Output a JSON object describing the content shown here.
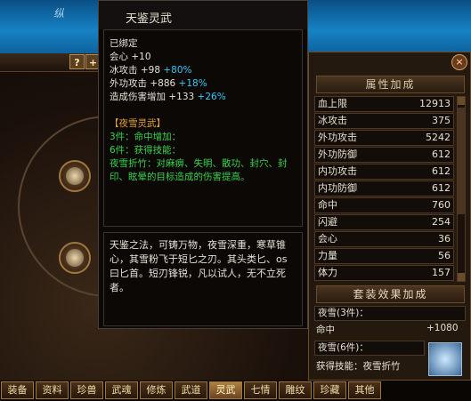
{
  "background": {
    "sky_text": "纵"
  },
  "top_buttons": {
    "help": "?",
    "plus": "+",
    "close": "×"
  },
  "tooltip": {
    "title": "天鉴灵武",
    "bound": "已绑定",
    "stats": [
      {
        "label": "会心",
        "base": "+10",
        "bonus": ""
      },
      {
        "label": "冰攻击",
        "base": "+98",
        "bonus": "+80%"
      },
      {
        "label": "外功攻击",
        "base": "+886",
        "bonus": "+18%"
      },
      {
        "label": "造成伤害增加",
        "base": "+133",
        "bonus": "+26%"
      }
    ],
    "set_name": "【夜雪灵武】",
    "set_3": "3件：命中增加：",
    "set_6": "6件：获得技能：",
    "skill_desc": "夜雪折竹：对麻痹、失明、散功、封穴、封印、眩晕的目标造成的伤害提高。",
    "description": "天鉴之法，可铸万物，夜雪深重，寒草锥心，其雪粉飞于短匕之刃。其头类匕、os曰匕首。短刃锋锐，凡以试人，无不立死者。"
  },
  "attr_panel": {
    "header": "属性加成",
    "rows": [
      {
        "label": "血上限",
        "value": "12913"
      },
      {
        "label": "冰攻击",
        "value": "375"
      },
      {
        "label": "外功攻击",
        "value": "5242"
      },
      {
        "label": "外功防御",
        "value": "612"
      },
      {
        "label": "内功攻击",
        "value": "612"
      },
      {
        "label": "内功防御",
        "value": "612"
      },
      {
        "label": "命中",
        "value": "760"
      },
      {
        "label": "闪避",
        "value": "254"
      },
      {
        "label": "会心",
        "value": "36"
      },
      {
        "label": "力量",
        "value": "56"
      },
      {
        "label": "体力",
        "value": "157"
      }
    ],
    "set_header": "套装效果加成",
    "set_3_label": "夜雪(3件)：",
    "set_3_stat": "命中",
    "set_3_value": "+1080",
    "set_6_label": "夜雪(6件)：",
    "set_6_skill": "获得技能：夜雪折竹"
  },
  "tabs": [
    "装备",
    "资料",
    "珍兽",
    "武魂",
    "修炼",
    "武道",
    "灵武",
    "七情",
    "雕纹",
    "珍藏",
    "其他"
  ],
  "active_tab": "灵武"
}
